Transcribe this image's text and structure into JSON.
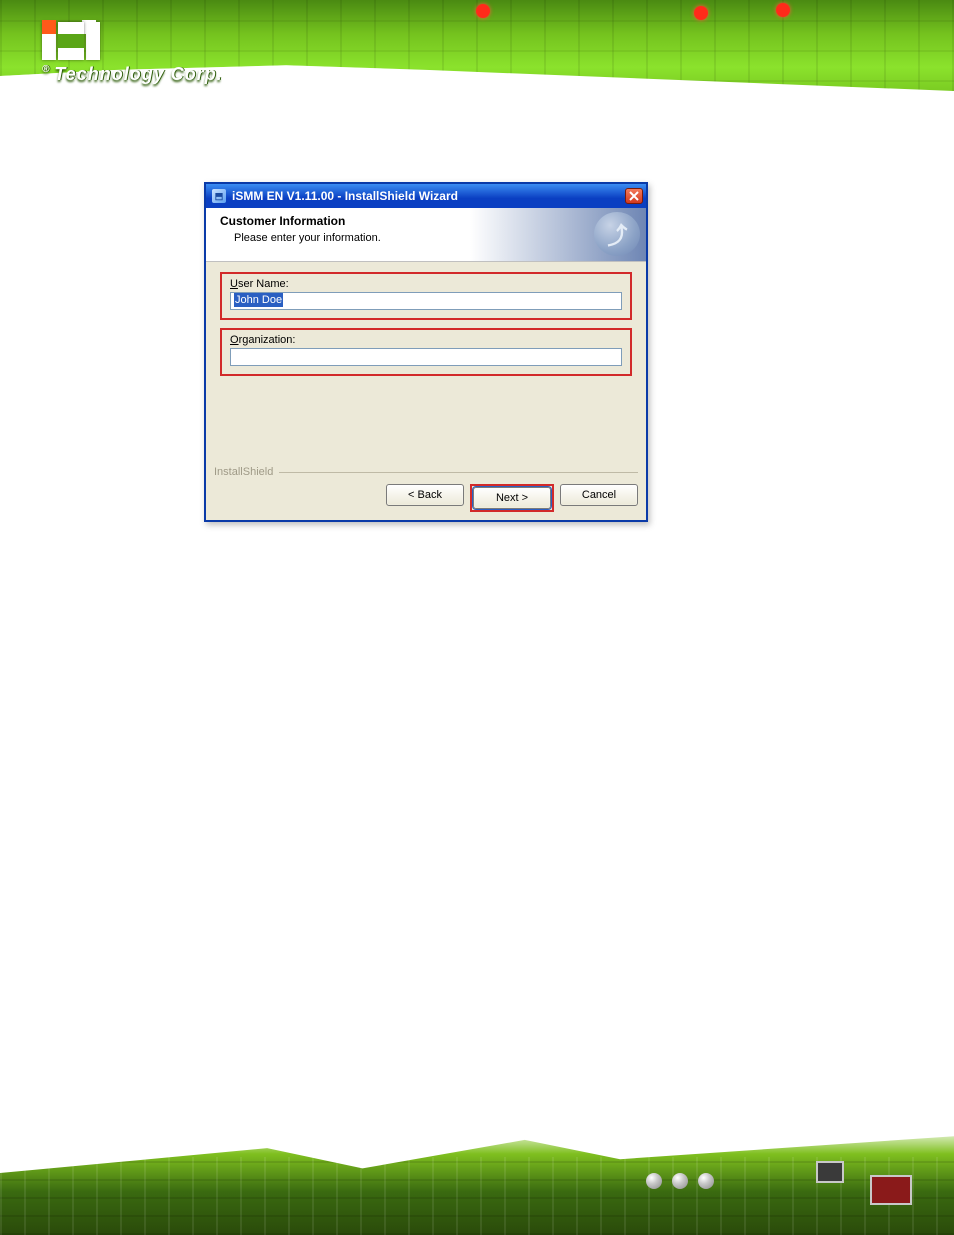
{
  "branding": {
    "logo_text": "Technology Corp.",
    "reg": "®"
  },
  "dialog": {
    "window_title": "iSMM EN V1.11.00 - InstallShield Wizard",
    "header_title": "Customer Information",
    "header_subtitle": "Please enter your information.",
    "user_label_prefix": "U",
    "user_label_rest": "ser Name:",
    "user_value": "John Doe",
    "org_label_prefix": "O",
    "org_label_rest": "rganization:",
    "org_value": "",
    "brand_footer": "InstallShield",
    "back_label": "< Back",
    "next_label": "Next >",
    "cancel_label": "Cancel"
  }
}
